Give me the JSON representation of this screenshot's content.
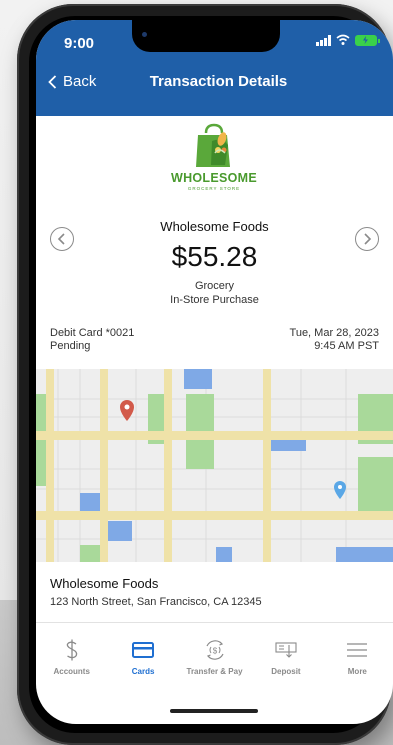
{
  "status_bar": {
    "time": "9:00"
  },
  "nav": {
    "back_label": "Back",
    "title": "Transaction Details"
  },
  "logo": {
    "word": "WHOLESOME",
    "sub": "GROCERY STORE"
  },
  "transaction": {
    "merchant": "Wholesome Foods",
    "amount": "$55.28",
    "category": "Grocery",
    "method": "In-Store Purchase",
    "card": "Debit Card *0021",
    "status": "Pending",
    "date": "Tue, Mar 28, 2023",
    "time": "9:45 AM PST"
  },
  "location": {
    "name": "Wholesome Foods",
    "address": "123 North Street, San Francisco, CA 12345"
  },
  "tabs": [
    {
      "label": "Accounts",
      "icon": "dollar-icon"
    },
    {
      "label": "Cards",
      "icon": "card-icon",
      "active": true
    },
    {
      "label": "Transfer & Pay",
      "icon": "transfer-icon"
    },
    {
      "label": "Deposit",
      "icon": "deposit-icon"
    },
    {
      "label": "More",
      "icon": "menu-icon"
    }
  ],
  "colors": {
    "header": "#1f5fa8",
    "active_tab": "#1f6fd1",
    "brand_green": "#4a9a2e",
    "map_road": "#efe2a8",
    "map_park": "#a9d99a",
    "map_water": "#7fa9e6"
  }
}
